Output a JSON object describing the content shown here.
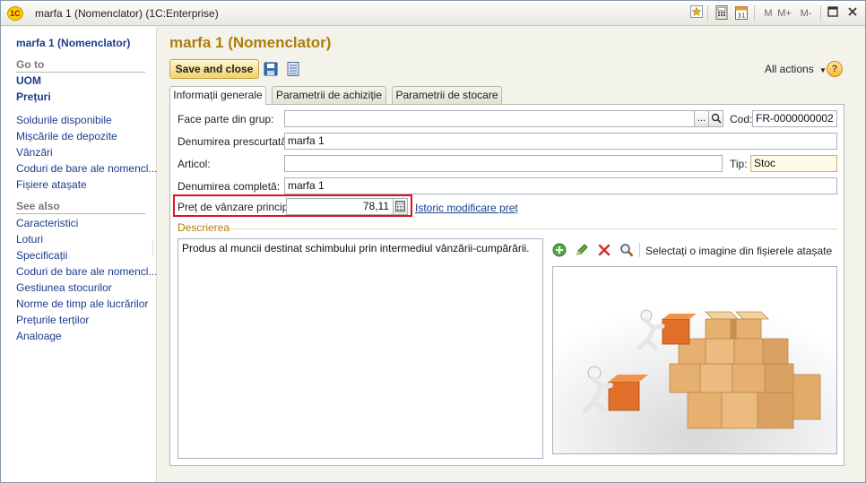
{
  "titlebar": {
    "logo": "1C",
    "title": "marfa 1 (Nomenclator)   (1C:Enterprise)",
    "buttons": [
      "M",
      "M+",
      "M-"
    ],
    "icons": [
      "favorite-icon",
      "calculator-icon",
      "calendar-icon",
      "restore-icon",
      "close-icon"
    ]
  },
  "nav": {
    "title": "marfa 1 (Nomenclator)",
    "goto_label": "Go to",
    "goto_items": [
      "UOM",
      "Prețuri"
    ],
    "links": [
      "Soldurile disponibile",
      "Mișcările de depozite",
      "Vânzări",
      "Coduri de bare ale nomencl...",
      "Fișiere atașate"
    ],
    "seealso_label": "See also",
    "seealso_items": [
      "Caracteristici",
      "Loturi",
      "Specificații",
      "Coduri de bare ale nomencl...",
      "Gestiunea stocurilor",
      "Norme de timp ale lucrărilor",
      "Prețurile terților",
      "Analoage"
    ]
  },
  "main": {
    "title": "marfa 1 (Nomenclator)",
    "save_close": "Save and close",
    "all_actions": "All actions",
    "help": "?",
    "tabs": [
      "Informații generale",
      "Parametrii de achiziție",
      "Parametrii de stocare"
    ]
  },
  "form": {
    "group_label": "Face parte din grup:",
    "group_value": "",
    "browse_btn": "...",
    "code_label": "Cod:",
    "code_value": "FR-0000000002",
    "short_name_label": "Denumirea prescurtată :",
    "short_name_value": "marfa 1",
    "article_label": "Articol:",
    "article_value": "",
    "type_label": "Tip:",
    "type_value": "Stoc",
    "full_name_label": "Denumirea completă:",
    "full_name_value": "marfa 1",
    "price_label": "Preț de vânzare principal:",
    "price_value": "78,11",
    "price_history_link": "Istoric modificare preț",
    "description_title": "Descrierea",
    "description_text": "Produs al muncii destinat schimbului prin intermediul vânzării-cumpărării.",
    "image_hint": "Selectați o imagine din fișierele atașate"
  },
  "colors": {
    "accent": "#b07c0a",
    "link": "#1c3c8c",
    "highlight": "#e0141d"
  }
}
